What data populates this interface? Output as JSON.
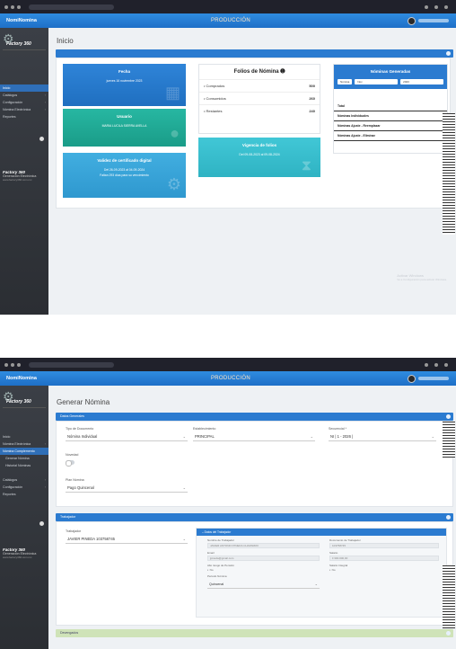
{
  "app": {
    "brand": "NomiNomina",
    "environment": "PRODUCCIÓN"
  },
  "sidebar_logo": {
    "line1": "Factory 360",
    "line2": "Generación Electrónica",
    "line3": "www.factory360.com.mx"
  },
  "screen1": {
    "page_title": "Inicio",
    "sidebar": [
      {
        "label": "Inicio",
        "active": true
      },
      {
        "label": "Catálogos"
      },
      {
        "label": "Configuración"
      },
      {
        "label": "Nómina Electrónica"
      },
      {
        "label": "Reportes"
      }
    ],
    "fecha_card": {
      "title": "Fecha",
      "value": "jueves 16 noviembre 2023"
    },
    "usuario_card": {
      "title": "Usuario",
      "value": "MARIA LUCILA SIERRA AVELLA"
    },
    "certificado_card": {
      "title": "Validez de certificado digital",
      "line1": "Del 26-09-2023 al 04-09-2024",
      "line2": "Faltan 293 días para su vencimiento"
    },
    "folios": {
      "title": "Folios de Nómina",
      "rows": [
        {
          "label": "Comprados",
          "value": "500"
        },
        {
          "label": "Consumidos",
          "value": "260"
        },
        {
          "label": "Restantes",
          "value": "240"
        }
      ]
    },
    "vigencia_card": {
      "title": "Vigencia de folios",
      "value": "Del 09-08-2023 al 09-08-2024"
    },
    "nominas": {
      "title": "Nóminas Generadas",
      "filter_label": "Nómina",
      "month": "Nov",
      "year": "2023",
      "rows": [
        "Total",
        "Nóminas Individuales",
        "Nóminas Ajuste - Reemplazar",
        "Nóminas Ajuste - Eliminar"
      ]
    },
    "watermark": {
      "line1": "Activar Windows",
      "line2": "Ve a Configuración para activar Windows."
    }
  },
  "screen2": {
    "page_title": "Generar Nómina",
    "sidebar": [
      {
        "label": "Inicio"
      },
      {
        "label": "Nómina Electrónica"
      },
      {
        "label": "Nómina Complemento",
        "active": true
      },
      {
        "label": "Generar Nómina"
      },
      {
        "label": "Historial Nóminas"
      },
      {
        "label": "Catálogos"
      },
      {
        "label": "Configuración"
      },
      {
        "label": "Reportes"
      }
    ],
    "datos_generales": {
      "header": "Datos Generales",
      "tipo_documento_label": "Tipo de Documento",
      "tipo_documento_value": "Nómina Individual",
      "establecimiento_label": "Establecimiento",
      "establecimiento_value": "PRINCIPAL",
      "secuencial_label": "Secuencial *",
      "secuencial_value": "NI | 1 - 2026 |",
      "novedad_label": "Novedad",
      "periodo_label": "Plan Nómina",
      "periodo_value": "Pago Quincenal"
    },
    "trabajador": {
      "header": "Trabajador",
      "trabajador_label": "Trabajador",
      "trabajador_value": "JAVIER PINEDA 103758745",
      "datos_header": "Datos del Trabajador",
      "fields": [
        {
          "label": "Nombre de Trabajador",
          "value": "JAVIER ANTONIO PINEDA CHAPARRO"
        },
        {
          "label": "Documento de Trabajador",
          "value": "103758745"
        },
        {
          "label": "Email",
          "value": "jpineda@gmail.com"
        },
        {
          "label": "Salario",
          "value": "1'300.000,00"
        },
        {
          "label": "Alto riesgo de Pensión",
          "value": "No"
        },
        {
          "label": "Salario Integral",
          "value": "No"
        },
        {
          "label": "Periodo Nómina",
          "value": "Quincenal"
        }
      ]
    },
    "devengados_header": "Devengados"
  }
}
